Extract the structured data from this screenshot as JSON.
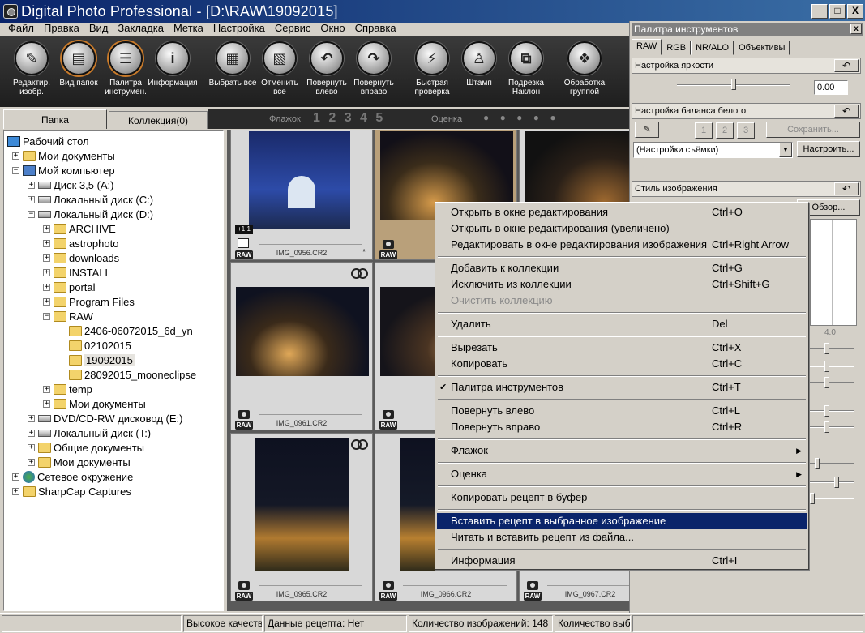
{
  "window": {
    "title": "Digital Photo Professional - [D:\\RAW\\19092015]",
    "minimize": "_",
    "maximize": "□",
    "close": "X"
  },
  "menu": [
    "Файл",
    "Правка",
    "Вид",
    "Закладка",
    "Метка",
    "Настройка",
    "Сервис",
    "Окно",
    "Справка"
  ],
  "toolbar": [
    {
      "label": "Редактир. изобр.",
      "icon": "edit-image-icon"
    },
    {
      "label": "Вид папок",
      "icon": "folder-view-icon"
    },
    {
      "label": "Палитра инструмен.",
      "icon": "tool-palette-icon"
    },
    {
      "label": "Информация",
      "icon": "info-icon"
    },
    {
      "label": "Выбрать все",
      "icon": "select-all-icon"
    },
    {
      "label": "Отменить все",
      "icon": "deselect-all-icon"
    },
    {
      "label": "Повернуть влево",
      "icon": "rotate-left-icon"
    },
    {
      "label": "Повернуть вправо",
      "icon": "rotate-right-icon"
    },
    {
      "label": "Быстрая проверка",
      "icon": "quick-check-icon"
    },
    {
      "label": "Штамп",
      "icon": "stamp-icon"
    },
    {
      "label": "Подрезка Наклон",
      "icon": "crop-icon"
    },
    {
      "label": "Обработка группой",
      "icon": "batch-process-icon"
    }
  ],
  "left_tabs": {
    "folder": "Папка",
    "collection": "Коллекция(0)"
  },
  "browse_bar": {
    "flag_label": "Флажок",
    "flag_numbers": "1 2 3 4 5",
    "rating_label": "Оценка",
    "rating_dots": "● ● ● ● ●"
  },
  "tree": [
    {
      "label": "Рабочий стол",
      "icon": "desktop-icon",
      "expander": ""
    },
    {
      "label": "Мои документы",
      "icon": "folder-icon",
      "expander": "+"
    },
    {
      "label": "Мой компьютер",
      "icon": "computer-icon",
      "expander": "−"
    },
    {
      "label": "Диск 3,5 (A:)",
      "icon": "floppy-icon",
      "expander": "+"
    },
    {
      "label": "Локальный диск (C:)",
      "icon": "drive-icon",
      "expander": "+"
    },
    {
      "label": "Локальный диск (D:)",
      "icon": "drive-icon",
      "expander": "−"
    },
    {
      "label": "ARCHIVE",
      "icon": "folder-icon",
      "expander": "+"
    },
    {
      "label": "astrophoto",
      "icon": "folder-icon",
      "expander": "+"
    },
    {
      "label": "downloads",
      "icon": "folder-icon",
      "expander": "+"
    },
    {
      "label": "INSTALL",
      "icon": "folder-icon",
      "expander": "+"
    },
    {
      "label": "portal",
      "icon": "folder-icon",
      "expander": "+"
    },
    {
      "label": "Program Files",
      "icon": "folder-icon",
      "expander": "+"
    },
    {
      "label": "RAW",
      "icon": "folder-icon",
      "expander": "−"
    },
    {
      "label": "2406-06072015_6d_yn",
      "icon": "folder-icon",
      "expander": ""
    },
    {
      "label": "02102015",
      "icon": "folder-icon",
      "expander": ""
    },
    {
      "label": "19092015",
      "icon": "folder-icon",
      "expander": "",
      "selected": true
    },
    {
      "label": "28092015_mooneclipse",
      "icon": "folder-icon",
      "expander": ""
    },
    {
      "label": "temp",
      "icon": "folder-icon",
      "expander": "+"
    },
    {
      "label": "Мои документы",
      "icon": "folder-icon",
      "expander": "+"
    },
    {
      "label": "DVD/CD-RW дисковод (E:)",
      "icon": "dvd-icon",
      "expander": "+"
    },
    {
      "label": "Локальный диск (T:)",
      "icon": "drive-icon",
      "expander": "+"
    },
    {
      "label": "Общие документы",
      "icon": "folder-icon",
      "expander": "+"
    },
    {
      "label": "Мои документы",
      "icon": "folder-icon",
      "expander": "+"
    },
    {
      "label": "Сетевое окружение",
      "icon": "network-icon",
      "expander": "+"
    },
    {
      "label": "SharpCap Captures",
      "icon": "folder-icon",
      "expander": "+"
    }
  ],
  "thumbnails": [
    {
      "filename": "IMG_0956.CR2",
      "badge": "RAW",
      "exposure": "+1.1",
      "edited": true,
      "asterisk": "*"
    },
    {
      "filename": "",
      "badge": "RAW",
      "selected": true
    },
    {
      "filename": "",
      "badge": ""
    },
    {
      "filename": "IMG_0961.CR2",
      "badge": "RAW"
    },
    {
      "filename": "",
      "badge": "RAW"
    },
    {
      "filename": "IMG_0965.CR2",
      "badge": "RAW"
    },
    {
      "filename": "IMG_0966.CR2",
      "badge": "RAW"
    },
    {
      "filename": "IMG_0967.CR2",
      "badge": "RAW"
    }
  ],
  "palette": {
    "title": "Палитра инструментов",
    "tabs": [
      "RAW",
      "RGB",
      "NR/ALO",
      "Объективы"
    ],
    "brightness_label": "Настройка яркости",
    "brightness_value": "0.00",
    "wb_label": "Настройка баланса белого",
    "wb_buttons": [
      "1",
      "2",
      "3"
    ],
    "wb_save": "Сохранить...",
    "wb_preset": "(Настройки съёмки)",
    "wb_configure": "Настроить...",
    "style_label": "Стиль изображения",
    "browse": "Обзор...",
    "graph_tick": "4.0",
    "reset_glyph": "↶"
  },
  "context_menu": [
    {
      "label": "Открыть в окне редактирования",
      "shortcut": "Ctrl+O"
    },
    {
      "label": "Открыть в окне редактирования (увеличено)",
      "shortcut": ""
    },
    {
      "label": "Редактировать в окне редактирования изображения",
      "shortcut": "Ctrl+Right Arrow"
    },
    {
      "sep": true
    },
    {
      "label": "Добавить к коллекции",
      "shortcut": "Ctrl+G"
    },
    {
      "label": "Исключить из коллекции",
      "shortcut": "Ctrl+Shift+G"
    },
    {
      "label": "Очистить коллекцию",
      "shortcut": "",
      "disabled": true
    },
    {
      "sep": true
    },
    {
      "label": "Удалить",
      "shortcut": "Del"
    },
    {
      "sep": true
    },
    {
      "label": "Вырезать",
      "shortcut": "Ctrl+X"
    },
    {
      "label": "Копировать",
      "shortcut": "Ctrl+C"
    },
    {
      "sep": true
    },
    {
      "label": "Палитра инструментов",
      "shortcut": "Ctrl+T",
      "checked": true
    },
    {
      "sep": true
    },
    {
      "label": "Повернуть влево",
      "shortcut": "Ctrl+L"
    },
    {
      "label": "Повернуть вправо",
      "shortcut": "Ctrl+R"
    },
    {
      "sep": true
    },
    {
      "label": "Флажок",
      "shortcut": "",
      "submenu": true
    },
    {
      "sep": true
    },
    {
      "label": "Оценка",
      "shortcut": "",
      "submenu": true
    },
    {
      "sep": true
    },
    {
      "label": "Копировать рецепт в буфер",
      "shortcut": ""
    },
    {
      "sep": true
    },
    {
      "label": "Вставить рецепт в выбранное изображение",
      "shortcut": "",
      "highlighted": true
    },
    {
      "label": "Читать и вставить рецепт из файла...",
      "shortcut": ""
    },
    {
      "sep": true
    },
    {
      "label": "Информация",
      "shortcut": "Ctrl+I"
    }
  ],
  "statusbar": {
    "quality": "Высокое качество",
    "recipe": "Данные рецепта: Нет",
    "count": "Количество изображений: 148",
    "selected": "Количество выбр"
  },
  "colors": {
    "title_start": "#0a246a",
    "title_end": "#3a6ea5",
    "menu_highlight": "#0a246a",
    "toolbar_bg": "#2a2a2a"
  }
}
